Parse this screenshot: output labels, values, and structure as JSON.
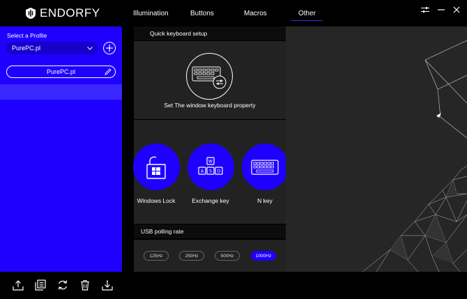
{
  "app": {
    "brand": "ENDORFY",
    "icons": [
      "endorfy-logo-icon",
      "settings-sliders-icon",
      "minimize-icon",
      "close-icon"
    ]
  },
  "nav": {
    "tabs": [
      {
        "label": "Illumination",
        "active": false
      },
      {
        "label": "Buttons",
        "active": false
      },
      {
        "label": "Macros",
        "active": false
      },
      {
        "label": "Other",
        "active": true
      }
    ]
  },
  "sidebar": {
    "select_label": "Select a Profile",
    "selected_profile": "PurePC.pl",
    "profile_button_label": "PurePC.pl"
  },
  "main": {
    "quick_setup": {
      "title": "Quick keyboard setup",
      "caption": "Set The window keyboard property"
    },
    "keys": [
      {
        "label": "Windows Lock",
        "icon": "windows-lock-icon"
      },
      {
        "label": "Exchange key",
        "icon": "wasd-keys-icon"
      },
      {
        "label": "N key",
        "icon": "keyboard-icon"
      }
    ],
    "usb": {
      "title": "USB polling rate",
      "options": [
        "125Hz",
        "250Hz",
        "500Hz",
        "1000Hz"
      ],
      "selected": "1000Hz"
    }
  },
  "bottom_toolbar": {
    "icons": [
      "import-icon",
      "document-icon",
      "refresh-icon",
      "delete-icon",
      "export-icon"
    ]
  },
  "colors": {
    "accent": "#1f00ff",
    "panel": "#222222",
    "background": "#000000",
    "right_background": "#262626"
  }
}
